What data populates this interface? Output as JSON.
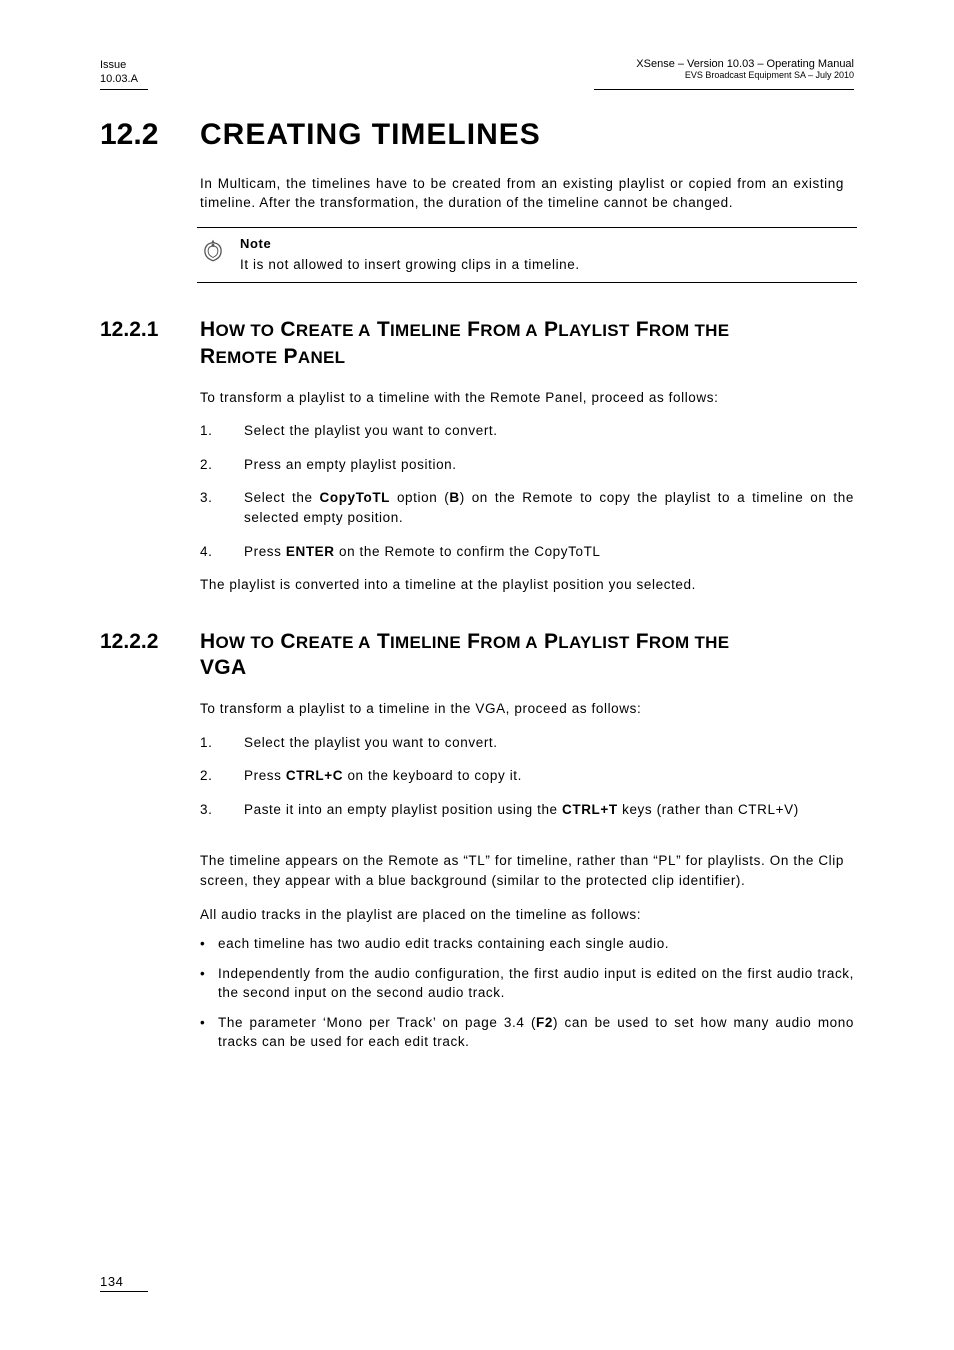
{
  "header": {
    "left_line1": "Issue",
    "left_line2": "10.03.A",
    "right_title": "XSense – Version 10.03 – Operating Manual",
    "right_sub": "EVS Broadcast Equipment SA – July 2010"
  },
  "section": {
    "num": "12.2",
    "title": "CREATING TIMELINES",
    "intro": "In Multicam, the timelines have to be created from an existing playlist or copied from an existing timeline. After the transformation, the duration of the timeline cannot be changed."
  },
  "note": {
    "label": "Note",
    "text": "It is not allowed to insert growing clips in a timeline."
  },
  "sub1": {
    "num": "12.2.1",
    "title_l1": "HOW TO CREATE A TIMELINE FROM A PLAYLIST FROM THE",
    "title_l2": "REMOTE PANEL",
    "intro": "To transform a playlist to a timeline with the Remote Panel, proceed as follows:",
    "steps": {
      "s1": {
        "n": "1.",
        "t": "Select the playlist you want to convert."
      },
      "s2": {
        "n": "2.",
        "t": "Press an empty playlist position."
      },
      "s3": {
        "n": "3.",
        "pre": "Select the ",
        "bold1": "CopyToTL",
        "mid": " option (",
        "bold2": "B",
        "post": ") on the Remote to copy the playlist to a timeline on the selected empty position."
      },
      "s4": {
        "n": "4.",
        "pre": "Press ",
        "bold1": "ENTER",
        "post": " on the Remote to confirm the CopyToTL"
      }
    },
    "outro": "The playlist is converted into a timeline at the playlist position you selected."
  },
  "sub2": {
    "num": "12.2.2",
    "title_l1": "HOW TO CREATE A TIMELINE FROM A PLAYLIST FROM THE",
    "title_l2": "VGA",
    "intro": "To transform a playlist to a timeline in the VGA, proceed as follows:",
    "steps": {
      "s1": {
        "n": "1.",
        "t": "Select the playlist you want to convert."
      },
      "s2": {
        "n": "2.",
        "pre": "Press ",
        "bold1": "CTRL+C",
        "post": " on the keyboard to copy it."
      },
      "s3": {
        "n": "3.",
        "pre": "Paste it into an empty playlist position using the ",
        "bold1": "CTRL+T",
        "post": " keys (rather than CTRL+V)"
      }
    },
    "para1": "The timeline appears on the Remote as “TL” for timeline, rather than “PL” for playlists. On the Clip screen, they appear with a blue background (similar to the protected clip identifier).",
    "para2": "All audio tracks in the playlist are placed on the timeline as follows:",
    "bullets": {
      "b1": "each timeline has two audio edit tracks containing each single audio.",
      "b2": "Independently from the audio configuration, the first audio input is edited on the first audio track, the second input on the second audio track.",
      "b3": {
        "pre": "The parameter ‘Mono per Track’ on page 3.4 (",
        "bold": "F2",
        "post": ") can be used to set how many audio mono tracks can be used for each edit track."
      }
    }
  },
  "footer": {
    "page": "134"
  }
}
